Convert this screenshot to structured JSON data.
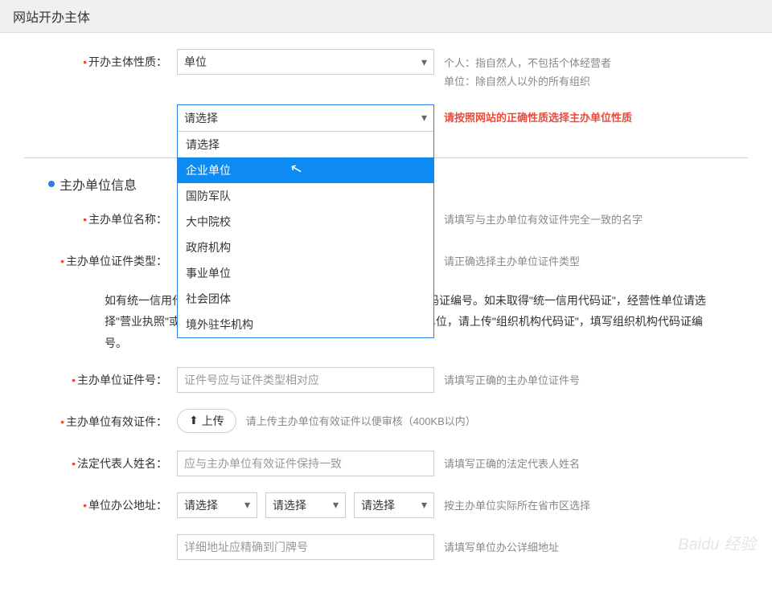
{
  "header": {
    "title": "网站开办主体"
  },
  "entity_type": {
    "label": "开办主体性质：",
    "value": "单位",
    "hint1": "个人：指自然人，不包括个体经营者",
    "hint2": "单位：除自然人以外的所有组织"
  },
  "sub_type": {
    "selected": "请选择",
    "options": [
      "请选择",
      "企业单位",
      "国防军队",
      "大中院校",
      "政府机构",
      "事业单位",
      "社会团体",
      "境外驻华机构"
    ],
    "hint": "请按照网站的正确性质选择主办单位性质"
  },
  "section": {
    "title": "主办单位信息"
  },
  "org_name": {
    "label": "主办单位名称：",
    "hint": "请填写与主办单位有效证件完全一致的名字"
  },
  "cert_type": {
    "label": "主办单位证件类型：",
    "hint": "请正确选择主办单位证件类型"
  },
  "paragraph": "如有统一信用代码证，请选择\"统一信用代码证\"，填写统一信用代码证编号。如未取得\"统一信用代码证\"，经营性单位请选择\"营业执照\"或\"组织机构代码\"证，并填写对应的编号；非经营性单位，请上传\"组织机构代码证\"，填写组织机构代码证编号。",
  "cert_no": {
    "label": "主办单位证件号：",
    "placeholder": "证件号应与证件类型相对应",
    "hint": "请填写正确的主办单位证件号"
  },
  "valid_cert": {
    "label": "主办单位有效证件：",
    "btn": "上传",
    "hint": "请上传主办单位有效证件以便审核（400KB以内）"
  },
  "legal_name": {
    "label": "法定代表人姓名：",
    "placeholder": "应与主办单位有效证件保持一致",
    "hint": "请填写正确的法定代表人姓名"
  },
  "address": {
    "label": "单位办公地址：",
    "sel": "请选择",
    "hint": "按主办单位实际所在省市区选择",
    "placeholder": "详细地址应精确到门牌号",
    "hint2": "请填写单位办公详细地址"
  },
  "watermark": "Baidu 经验"
}
